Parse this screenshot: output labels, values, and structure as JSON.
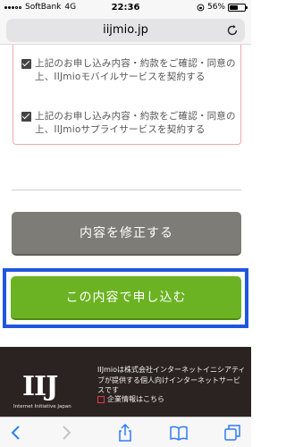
{
  "status_bar": {
    "carrier": "SoftBank",
    "network": "4G",
    "time": "22:36",
    "battery_percent": "56%",
    "battery_level": 0.56
  },
  "browser": {
    "url": "iijmio.jp"
  },
  "agreements": [
    {
      "label": "上記のお申し込み内容・約款をご確認・同意の上、IIJmioモバイルサービスを契約する",
      "checked": true
    },
    {
      "label": "上記のお申し込み内容・約款をご確認・同意の上、IIJmioサプライサービスを契約する",
      "checked": true
    }
  ],
  "buttons": {
    "edit": "内容を修正する",
    "submit": "この内容で申し込む"
  },
  "footer": {
    "logo_text": "IIJ",
    "logo_subtitle": "Internet Initiative Japan",
    "description": "IIJmioは株式会社インターネットイニシアティブが提供する個人向けインターネットサービスです",
    "company_link": "企業情報はこちら"
  },
  "colors": {
    "submit_green": "#6bb323",
    "edit_gray": "#7d7c76",
    "highlight_blue": "#1f56e0",
    "footer_bg": "#2b2321"
  }
}
